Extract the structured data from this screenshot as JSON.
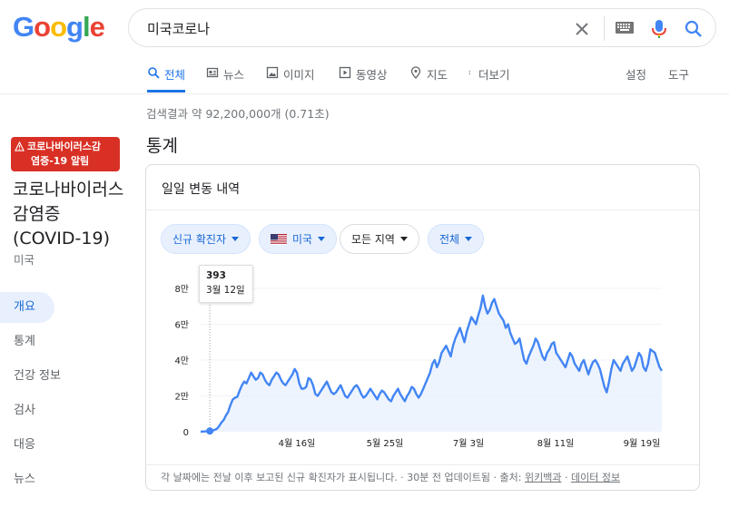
{
  "logo": {
    "letters": [
      "G",
      "o",
      "o",
      "g",
      "l",
      "e"
    ],
    "colors": [
      "#4285f4",
      "#ea4335",
      "#fbbc05",
      "#4285f4",
      "#34a853",
      "#ea4335"
    ]
  },
  "search": {
    "query": "미국코로나"
  },
  "tabs": [
    {
      "label": "전체",
      "icon": "search-icon",
      "active": true
    },
    {
      "label": "뉴스",
      "icon": "news-icon"
    },
    {
      "label": "이미지",
      "icon": "image-icon"
    },
    {
      "label": "동영상",
      "icon": "video-icon"
    },
    {
      "label": "지도",
      "icon": "map-pin-icon"
    },
    {
      "label": "더보기",
      "icon": "more-vert-icon"
    }
  ],
  "tools": {
    "settings": "설정",
    "tools": "도구"
  },
  "result_stats": "검색결과 약 92,200,000개 (0.71초)",
  "alert": {
    "line1": "코로나바이러스감",
    "line2": "염증-19 알림"
  },
  "entity": {
    "title": "코로나바이러스 감염증 (COVID-19)",
    "subtitle": "미국"
  },
  "side_nav": [
    "개요",
    "통계",
    "건강 정보",
    "검사",
    "대응",
    "뉴스"
  ],
  "section_title": "통계",
  "card": {
    "title": "일일 변동 내역",
    "chips": [
      {
        "label": "신규 확진자",
        "style": "blue"
      },
      {
        "label": "미국",
        "style": "blue",
        "flag": true
      },
      {
        "label": "모든 지역",
        "style": "plain"
      },
      {
        "label": "전체",
        "style": "blue"
      }
    ],
    "tooltip": {
      "value": "393",
      "date": "3월 12일"
    },
    "footer": {
      "text": "각 날짜에는 전날 이후 보고된 신규 확진자가 표시됩니다. · 30분 전 업데이트됨 · 출처: ",
      "link1": "위키백과",
      "sep": " · ",
      "link2": "데이터 정보"
    }
  },
  "colors": {
    "accent": "#1a73e8",
    "line": "#4285f4",
    "alert": "#d93025"
  },
  "chart_data": {
    "type": "area",
    "x_ticks": [
      "4월 16일",
      "5월 25일",
      "7월 3일",
      "8월 11일",
      "9월 19일"
    ],
    "y_ticks": [
      "0",
      "2만",
      "4만",
      "6만",
      "8만"
    ],
    "ylim": [
      0,
      80000
    ],
    "highlight": {
      "x": "3월 12일",
      "y": 393
    },
    "series": [
      {
        "values": [
          0,
          100,
          200,
          300,
          393,
          500,
          1000,
          1500,
          3000,
          5000,
          6500,
          9000,
          11000,
          15000,
          18000,
          19000,
          19500,
          23000,
          26000,
          28000,
          27000,
          30000,
          33000,
          31000,
          29000,
          30000,
          33000,
          32000,
          29000,
          27000,
          26000,
          29000,
          31000,
          33000,
          32000,
          29000,
          27000,
          26000,
          28000,
          30000,
          32000,
          35000,
          33000,
          27000,
          24000,
          24000,
          25000,
          30000,
          29000,
          26000,
          21000,
          20000,
          22000,
          24000,
          26000,
          28000,
          25000,
          22000,
          21000,
          22000,
          24000,
          26000,
          23000,
          20000,
          19000,
          21000,
          23000,
          25000,
          26000,
          24000,
          21000,
          19000,
          20000,
          22000,
          24000,
          22000,
          20000,
          18000,
          21000,
          23000,
          22000,
          20000,
          18000,
          17000,
          20000,
          22000,
          24000,
          21000,
          19000,
          17000,
          20000,
          22000,
          25000,
          24000,
          21000,
          19000,
          21000,
          24000,
          27000,
          30000,
          33000,
          38000,
          40000,
          36000,
          39000,
          44000,
          46000,
          48000,
          45000,
          42000,
          48000,
          52000,
          55000,
          58000,
          54000,
          50000,
          56000,
          60000,
          64000,
          62000,
          60000,
          65000,
          69000,
          76000,
          70000,
          66000,
          68000,
          72000,
          74000,
          70000,
          66000,
          64000,
          62000,
          58000,
          60000,
          55000,
          52000,
          49000,
          50000,
          52000,
          46000,
          40000,
          38000,
          42000,
          45000,
          48000,
          52000,
          50000,
          46000,
          42000,
          40000,
          44000,
          46000,
          49000,
          50000,
          44000,
          42000,
          40000,
          38000,
          36000,
          40000,
          44000,
          42000,
          38000,
          36000,
          34000,
          38000,
          40000,
          36000,
          32000,
          36000,
          39000,
          40000,
          38000,
          35000,
          30000,
          25000,
          22000,
          28000,
          35000,
          40000,
          38000,
          36000,
          34000,
          38000,
          40000,
          42000,
          38000,
          34000,
          36000,
          40000,
          44000,
          42000,
          36000,
          34000,
          38000,
          46000,
          45000,
          44000,
          40000,
          36000,
          34000
        ]
      }
    ]
  }
}
